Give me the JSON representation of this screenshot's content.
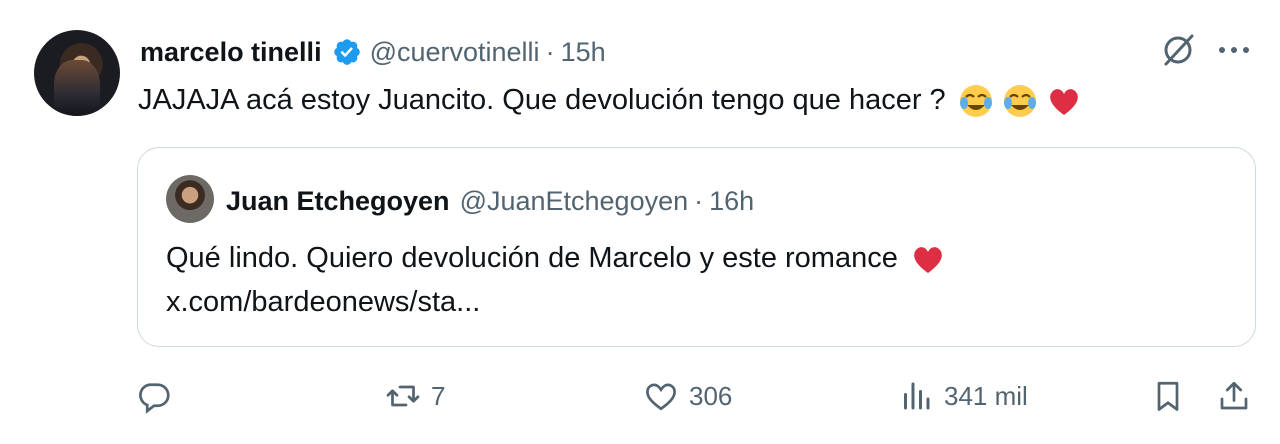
{
  "tweet": {
    "author_name": "marcelo tinelli",
    "author_handle": "@cuervotinelli",
    "separator": "·",
    "time": "15h",
    "text": "JAJAJA acá estoy Juancito. Que devolución tengo que hacer ?",
    "emojis": [
      "face-with-tears-of-joy",
      "face-with-tears-of-joy",
      "red-heart"
    ]
  },
  "quote": {
    "author_name": "Juan Etchegoyen",
    "author_handle": "@JuanEtchegoyen",
    "separator": "·",
    "time": "16h",
    "text_line1": "Qué lindo. Quiero devolución de Marcelo y este romance",
    "text_line2": "x.com/bardeonews/sta...",
    "emojis": [
      "red-heart"
    ]
  },
  "actions": {
    "reply_count": "",
    "retweet_count": "7",
    "like_count": "306",
    "views_count": "341 mil"
  },
  "colors": {
    "verified": "#1d9bf0",
    "heart": "#e0245e",
    "muted": "#536471",
    "text": "#0f1419",
    "border": "#cfd9de"
  },
  "icons": [
    "verified-badge-icon",
    "grok-icon",
    "more-options-icon",
    "reply-icon",
    "retweet-icon",
    "like-icon",
    "views-icon",
    "bookmark-icon",
    "share-icon"
  ]
}
